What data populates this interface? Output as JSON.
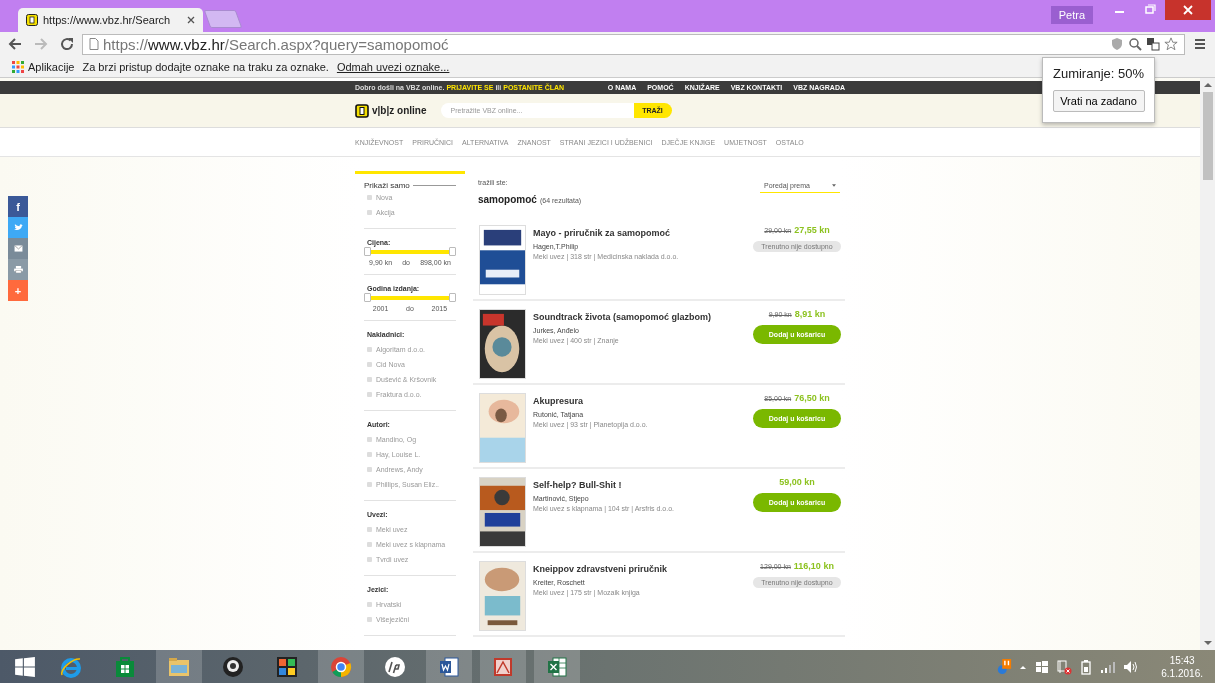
{
  "browser": {
    "tabs": [
      {
        "title": "https://www.vbz.hr/Search",
        "selected": true
      }
    ],
    "profile": "Petra",
    "address": {
      "scheme": "https://",
      "host": "www.vbz.hr",
      "path": "/Search.aspx?query=samopomoć"
    },
    "bookmarks": {
      "apps": "Aplikacije",
      "hint": "Za brzi pristup dodajte oznake na traku za oznake.",
      "link": "Odmah uvezi oznake..."
    },
    "zoom_popup": {
      "label": "Zumiranje: 50%",
      "button": "Vrati na zadano"
    }
  },
  "site": {
    "welcome": "Dobro došli na VBZ online.",
    "login": "PRIJAVITE SE",
    "or": "ili",
    "join": "POSTANITE ČLAN",
    "top_links": [
      "O NAMA",
      "POMOĆ",
      "KNJIŽARE",
      "VBZ KONTAKTI",
      "VBZ NAGRADA"
    ],
    "logo": "v|b|z online",
    "search_placeholder": "Pretražite VBZ online...",
    "search_button": "TRAŽI",
    "categories": [
      "KNJIŽEVNOST",
      "PRIRUČNICI",
      "ALTERNATIVA",
      "ZNANOST",
      "STRANI JEZICI I UDŽBENICI",
      "DJEČJE KNJIGE",
      "UMJETNOST",
      "OSTALO"
    ],
    "social": [
      {
        "kind": "facebook",
        "glyph": "f"
      },
      {
        "kind": "twitter"
      },
      {
        "kind": "mail"
      },
      {
        "kind": "print"
      },
      {
        "kind": "more",
        "glyph": "+"
      }
    ],
    "filters": {
      "show_only": {
        "title": "Prikaži samo",
        "options": [
          {
            "label": "Nova",
            "checked": false
          },
          {
            "label": "Akcija",
            "checked": false
          }
        ]
      },
      "ranges": [
        {
          "title": "Cijena:",
          "level": 1,
          "from": "9,90 kn",
          "to_word": "do",
          "to": "898,00 kn"
        },
        {
          "title": "Godina izdanja:",
          "level": 1,
          "from": "2001",
          "to_word": "do",
          "to": "2015"
        }
      ],
      "groups": [
        {
          "title": "Nakladnici:",
          "options": [
            {
              "label": "Algoritam d.o.o.",
              "checked": false
            },
            {
              "label": "Cid Nova",
              "checked": false
            },
            {
              "label": "Dušević & Kršovnik",
              "checked": false
            },
            {
              "label": "Fraktura d.o.o.",
              "checked": false
            }
          ]
        },
        {
          "title": "Autori:",
          "options": [
            {
              "label": "Mandino, Og",
              "checked": false
            },
            {
              "label": "Hay, Louise L.",
              "checked": false
            },
            {
              "label": "Andrews, Andy",
              "checked": false
            },
            {
              "label": "Phillips, Susan Eliz..",
              "checked": false
            }
          ]
        },
        {
          "title": "Uvezi:",
          "options": [
            {
              "label": "Meki uvez",
              "checked": false
            },
            {
              "label": "Meki uvez s klapnama",
              "checked": false
            },
            {
              "label": "Tvrdi uvez",
              "checked": false
            }
          ]
        },
        {
          "title": "Jezici:",
          "options": [
            {
              "label": "Hrvatski",
              "checked": false
            },
            {
              "label": "Višejezični",
              "checked": false
            }
          ]
        }
      ]
    },
    "results": {
      "query_label": "tražili ste:",
      "query": "samopomoć",
      "count": "(64 rezultata)",
      "sort": "Poredaj prema",
      "items": [
        {
          "title": "Mayo - priručnik za samopomoć",
          "author": "Hagen,T.Philip",
          "meta": "Meki uvez | 318 str | Medicinska naklada d.o.o.",
          "old_price": "29,00 kn",
          "price": "27,55 kn",
          "action": {
            "kind": "unavailable",
            "label": "Trenutno nije dostupno"
          }
        },
        {
          "title": "Soundtrack života (samopomoć glazbom)",
          "author": "Jurkes, Anđelo",
          "meta": "Meki uvez | 400 str | Znanje",
          "old_price": "9,90 kn",
          "price": "8,91 kn",
          "action": {
            "kind": "cart",
            "label": "Dodaj u košaricu"
          }
        },
        {
          "title": "Akupresura",
          "author": "Rutonić, Tatjana",
          "meta": "Meki uvez | 93 str | Planetopija d.o.o.",
          "old_price": "85,00 kn",
          "price": "76,50 kn",
          "action": {
            "kind": "cart",
            "label": "Dodaj u košaricu"
          }
        },
        {
          "title": "Self-help? Bull-Shit !",
          "author": "Martinović, Stjepo",
          "meta": "Meki uvez s klapnama | 104 str | Arsfris d.o.o.",
          "price": "59,00 kn",
          "action": {
            "kind": "cart",
            "label": "Dodaj u košaricu"
          }
        },
        {
          "title": "Kneippov zdravstveni priručnik",
          "author": "Kreiter, Roschett",
          "meta": "Meki uvez | 175 str | Mozaik knjiga",
          "old_price": "129,00 kn",
          "price": "116,10 kn",
          "action": {
            "kind": "unavailable",
            "label": "Trenutno nije dostupno"
          }
        }
      ]
    }
  },
  "taskbar": {
    "apps": [
      {
        "kind": "ie",
        "running": false
      },
      {
        "kind": "store",
        "running": false
      },
      {
        "kind": "folder",
        "running": true
      },
      {
        "kind": "webcam",
        "running": false
      },
      {
        "kind": "puzzle",
        "running": false
      },
      {
        "kind": "chrome",
        "running": true
      },
      {
        "kind": "hp",
        "running": false
      },
      {
        "kind": "word",
        "running": true
      },
      {
        "kind": "pdf",
        "running": true
      },
      {
        "kind": "excel",
        "running": true
      }
    ],
    "time": "15:43",
    "date": "6.1.2016."
  }
}
